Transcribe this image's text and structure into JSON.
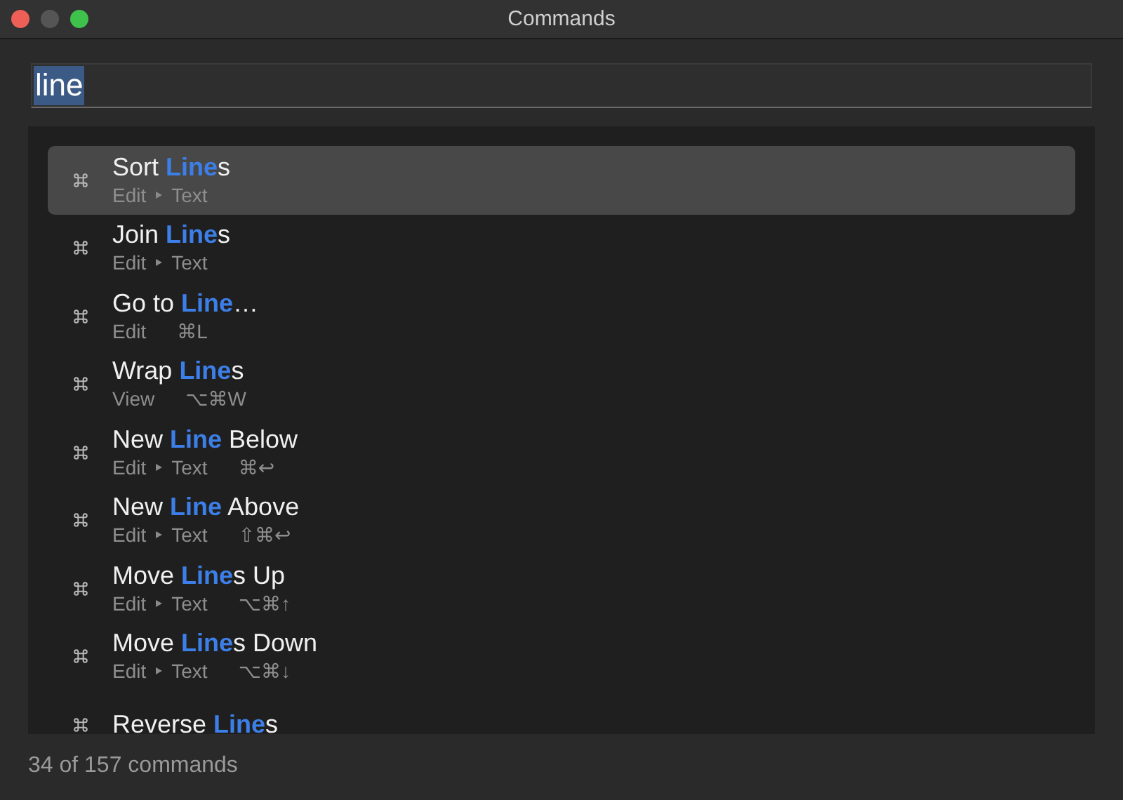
{
  "window": {
    "title": "Commands"
  },
  "search": {
    "value": "line",
    "text_selected": true
  },
  "commands": [
    {
      "title": "Sort **Line**s",
      "menu": [
        "Edit",
        "Text"
      ],
      "selected": true
    },
    {
      "title": "Join **Line**s",
      "menu": [
        "Edit",
        "Text"
      ],
      "selected": false
    },
    {
      "title": "Go to **Line**…",
      "menu": [
        "Edit"
      ],
      "shortcut": "⌘L",
      "selected": false
    },
    {
      "title": "Wrap **Line**s",
      "menu": [
        "View"
      ],
      "shortcut": "⌥⌘W",
      "selected": false
    },
    {
      "title": "New **Line** Below",
      "menu": [
        "Edit",
        "Text"
      ],
      "shortcut": "⌘↩",
      "selected": false
    },
    {
      "title": "New **Line** Above",
      "menu": [
        "Edit",
        "Text"
      ],
      "shortcut": "⇧⌘↩",
      "selected": false
    },
    {
      "title": "Move **Line**s Up",
      "menu": [
        "Edit",
        "Text"
      ],
      "shortcut": "⌥⌘↑",
      "selected": false
    },
    {
      "title": "Move **Line**s Down",
      "menu": [
        "Edit",
        "Text"
      ],
      "shortcut": "⌥⌘↓",
      "selected": false
    },
    {
      "title": "Reverse **Line**s",
      "selected": false
    }
  ],
  "status_bar": {
    "text": "34 of 157 commands"
  }
}
